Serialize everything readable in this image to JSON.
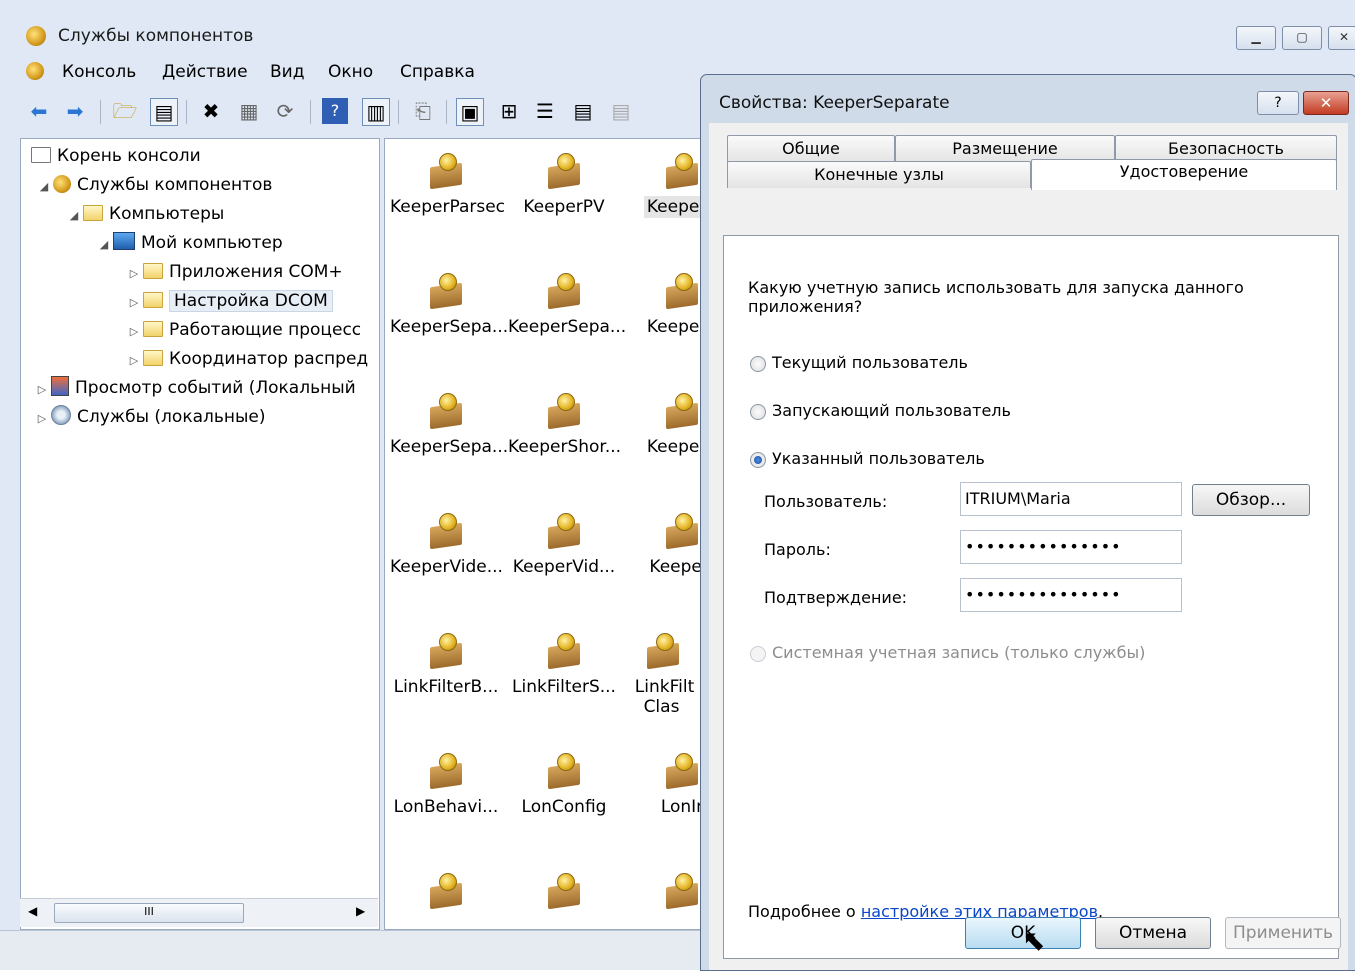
{
  "window": {
    "title": "Службы компонентов",
    "buttons": [
      "minimize",
      "maximize",
      "close"
    ]
  },
  "menu": [
    "Консоль",
    "Действие",
    "Вид",
    "Окно",
    "Справка"
  ],
  "toolbar": {
    "icons": [
      "back-arrow-icon",
      "forward-arrow-icon",
      "up-folder-icon",
      "show-hide-tree-icon",
      "delete-icon",
      "properties-icon",
      "refresh-icon",
      "help-icon",
      "action-pane-icon",
      "new-icon",
      "large-icons-view-icon",
      "small-icons-view-icon",
      "list-view-icon",
      "details-view-icon",
      "disabled-view-icon"
    ]
  },
  "tree": {
    "root": "Корень консоли",
    "component_services": "Службы компонентов",
    "computers": "Компьютеры",
    "my_computer": "Мой компьютер",
    "com_apps": "Приложения COM+",
    "dcom_config": "Настройка DCOM",
    "running_processes": "Работающие процесс",
    "coordinator": "Координатор распред",
    "event_viewer": "Просмотр событий (Локальный",
    "services": "Службы (локальные)"
  },
  "scrollbar": {
    "thumb_label": "III"
  },
  "components": [
    "KeeperParsec",
    "KeeperPV",
    "KeeperS",
    "KeeperSepa...",
    "KeeperSepa...",
    "KeeperS",
    "KeeperSepa...",
    "KeeperShor...",
    "KeeperS",
    "KeeperVide...",
    "KeeperVid...",
    "Keeper\\",
    "LinkFilterB...",
    "LinkFilterS...",
    "LinkFilt Clas",
    "LonBehavi...",
    "LonConfig",
    "LonIr",
    "",
    "",
    ""
  ],
  "dialog": {
    "title": "Свойства: KeeperSeparate",
    "help_label": "?",
    "close_label": "✕",
    "tabs_row1": [
      "Общие",
      "Размещение",
      "Безопасность"
    ],
    "tabs_row2": [
      "Конечные узлы",
      "Удостоверение"
    ],
    "question": "Какую учетную запись использовать для запуска данного приложения?",
    "options": {
      "current_user": "Текущий пользователь",
      "launching_user": "Запускающий пользователь",
      "specified_user": "Указанный пользователь",
      "system_account": "Системная учетная запись (только службы)"
    },
    "selected_option": "specified_user",
    "user_label": "Пользователь:",
    "user_value": "ITRIUM\\Maria",
    "browse_label": "Обзор...",
    "password_label": "Пароль:",
    "password_value": "•••••••••••••••",
    "confirm_label": "Подтверждение:",
    "confirm_value": "•••••••••••••••",
    "more_prefix": "Подробнее о ",
    "more_link": "настройке этих параметров",
    "more_suffix": ".",
    "ok_label": "OK",
    "cancel_label": "Отмена",
    "apply_label": "Применить"
  }
}
